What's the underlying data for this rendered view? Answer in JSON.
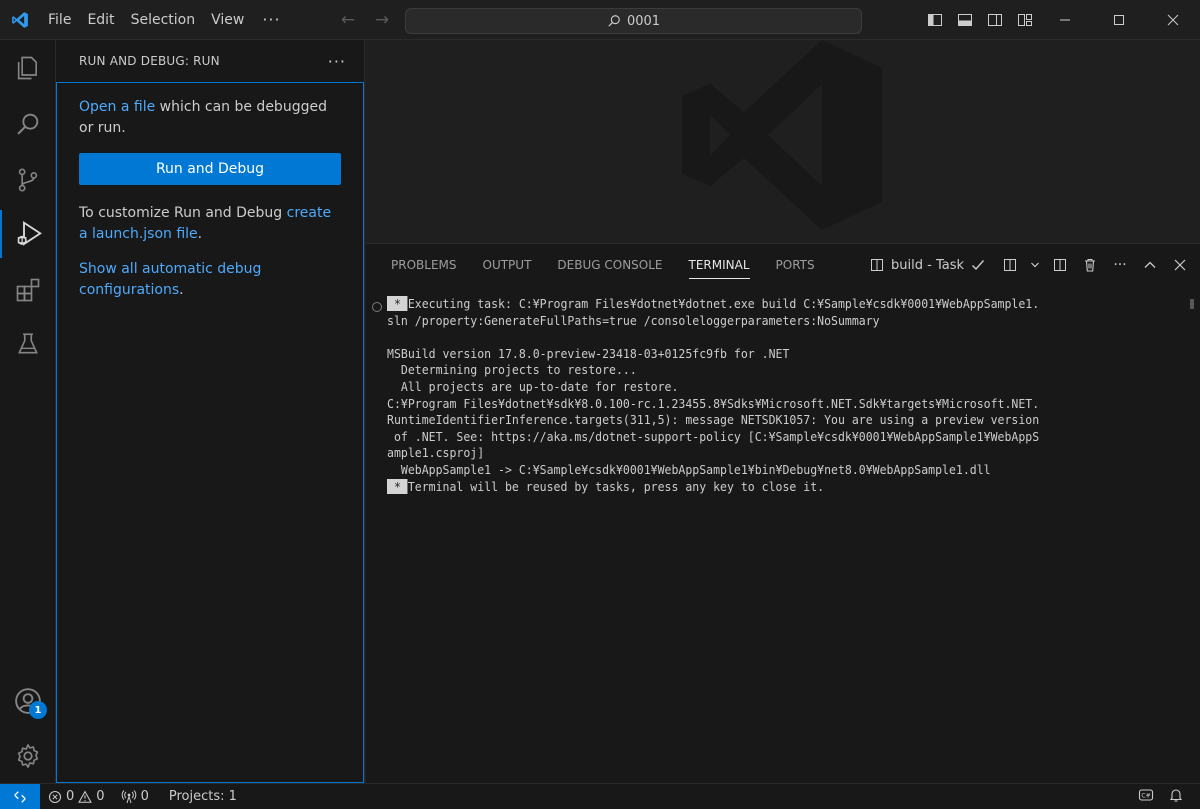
{
  "titlebar": {
    "menu": [
      "File",
      "Edit",
      "Selection",
      "View"
    ],
    "more": "···",
    "search_text": "0001",
    "icons": [
      "vscode-logo",
      "arrow-left-icon",
      "arrow-right-icon",
      "search-icon",
      "toggle-primary-sidebar-icon",
      "toggle-panel-icon",
      "toggle-secondary-sidebar-icon",
      "customize-layout-icon",
      "minimize-icon",
      "maximize-icon",
      "close-icon"
    ]
  },
  "activitybar": {
    "items": [
      "explorer-icon",
      "search-icon",
      "source-control-icon",
      "run-and-debug-icon",
      "extensions-icon",
      "testing-icon"
    ],
    "accounts_badge": "1",
    "bottom": [
      "accounts-icon",
      "manage-gear-icon"
    ]
  },
  "sidebar": {
    "title": "RUN AND DEBUG: RUN",
    "more": "···",
    "open_link": "Open a file",
    "open_rest": " which can be debugged or run.",
    "run_button": "Run and Debug",
    "customize_text": "To customize Run and Debug ",
    "customize_link": "create a launch.json file",
    "customize_end": ".",
    "show_link": "Show all automatic debug configurations",
    "show_end": "."
  },
  "panel": {
    "tabs": [
      "PROBLEMS",
      "OUTPUT",
      "DEBUG CONSOLE",
      "TERMINAL",
      "PORTS"
    ],
    "active_tab": "TERMINAL",
    "terminal_name": "build - Task",
    "terminal_lines": [
      " * Executing task: C:¥Program Files¥dotnet¥dotnet.exe build C:¥Sample¥csdk¥0001¥WebAppSample1.",
      "sln /property:GenerateFullPaths=true /consoleloggerparameters:NoSummary",
      "",
      "MSBuild version 17.8.0-preview-23418-03+0125fc9fb for .NET",
      "  Determining projects to restore...",
      "  All projects are up-to-date for restore.",
      "C:¥Program Files¥dotnet¥sdk¥8.0.100-rc.1.23455.8¥Sdks¥Microsoft.NET.Sdk¥targets¥Microsoft.NET.",
      "RuntimeIdentifierInference.targets(311,5): message NETSDK1057: You are using a preview version",
      " of .NET. See: https://aka.ms/dotnet-support-policy [C:¥Sample¥csdk¥0001¥WebAppSample1¥WebAppS",
      "ample1.csproj]",
      "  WebAppSample1 -> C:¥Sample¥csdk¥0001¥WebAppSample1¥bin¥Debug¥net8.0¥WebAppSample1.dll",
      " * Terminal will be reused by tasks, press any key to close it."
    ]
  },
  "statusbar": {
    "errors": "0",
    "warnings": "0",
    "ports": "0",
    "projects": "Projects: 1"
  },
  "colors": {
    "accent": "#0078d4",
    "link": "#4daafc",
    "background": "#1f1f1f",
    "sidebar": "#181818"
  }
}
